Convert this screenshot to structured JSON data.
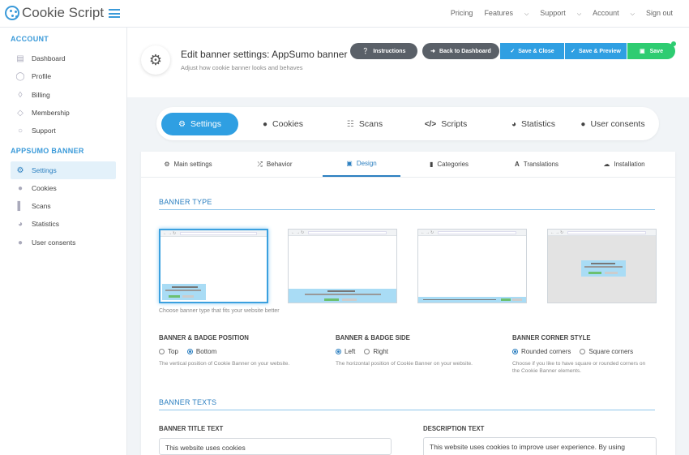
{
  "app": {
    "title": "Cookie Script"
  },
  "topnav": {
    "pricing": "Pricing",
    "features": "Features",
    "support": "Support",
    "account": "Account",
    "signout": "Sign out"
  },
  "sidebar": {
    "account_heading": "ACCOUNT",
    "account_items": [
      {
        "label": "Dashboard",
        "icon": "dashboard-icon"
      },
      {
        "label": "Profile",
        "icon": "user-icon"
      },
      {
        "label": "Billing",
        "icon": "tag-icon"
      },
      {
        "label": "Membership",
        "icon": "diamond-icon"
      },
      {
        "label": "Support",
        "icon": "chat-icon"
      }
    ],
    "banner_heading": "APPSUMO BANNER",
    "banner_items": [
      {
        "label": "Settings",
        "icon": "gears-icon",
        "active": true
      },
      {
        "label": "Cookies",
        "icon": "cookie-icon"
      },
      {
        "label": "Scans",
        "icon": "barcode-icon"
      },
      {
        "label": "Statistics",
        "icon": "pie-chart-icon"
      },
      {
        "label": "User consents",
        "icon": "users-icon"
      }
    ]
  },
  "header": {
    "title": "Edit banner settings: AppSumo banner",
    "subtitle": "Adjust how cookie banner looks and behaves",
    "buttons": {
      "instructions": "Instructions",
      "back": "Back to Dashboard",
      "save_close": "Save & Close",
      "save_preview": "Save & Preview",
      "save": "Save"
    },
    "colors": {
      "dark": "#5a6068",
      "blue": "#2f9fe2",
      "green": "#2ecc71"
    }
  },
  "main_tabs": [
    {
      "label": "Settings",
      "icon": "gears-icon",
      "active": true
    },
    {
      "label": "Cookies",
      "icon": "cookie-icon"
    },
    {
      "label": "Scans",
      "icon": "barcode-icon"
    },
    {
      "label": "Scripts",
      "icon": "code-icon"
    },
    {
      "label": "Statistics",
      "icon": "pie-chart-icon"
    },
    {
      "label": "User consents",
      "icon": "users-icon"
    }
  ],
  "sub_tabs": [
    {
      "label": "Main settings",
      "icon": "gear-icon"
    },
    {
      "label": "Behavior",
      "icon": "shuffle-icon"
    },
    {
      "label": "Design",
      "icon": "image-icon",
      "active": true
    },
    {
      "label": "Categories",
      "icon": "folder-icon"
    },
    {
      "label": "Translations",
      "icon": "font-icon"
    },
    {
      "label": "Installation",
      "icon": "cloud-icon"
    }
  ],
  "banner_type": {
    "heading": "BANNER TYPE",
    "hint": "Choose banner type that fits your website better",
    "selected_index": 0
  },
  "position": {
    "heading": "BANNER & BADGE POSITION",
    "options": [
      "Top",
      "Bottom"
    ],
    "selected": "Bottom",
    "description": "The vertical position of Cookie Banner on your website."
  },
  "side": {
    "heading": "BANNER & BADGE SIDE",
    "options": [
      "Left",
      "Right"
    ],
    "selected": "Left",
    "description": "The horizontal position of Cookie Banner on your website."
  },
  "corner": {
    "heading": "BANNER CORNER STYLE",
    "options": [
      "Rounded corners",
      "Square corners"
    ],
    "selected": "Rounded corners",
    "description": "Choose if you like to have square or rounded corners on the Cookie Banner elements."
  },
  "banner_texts": {
    "heading": "BANNER TEXTS",
    "title_label": "BANNER TITLE TEXT",
    "title_value": "This website uses cookies",
    "description_label": "DESCRIPTION TEXT",
    "description_value": "This website uses cookies to improve user experience. By using"
  }
}
